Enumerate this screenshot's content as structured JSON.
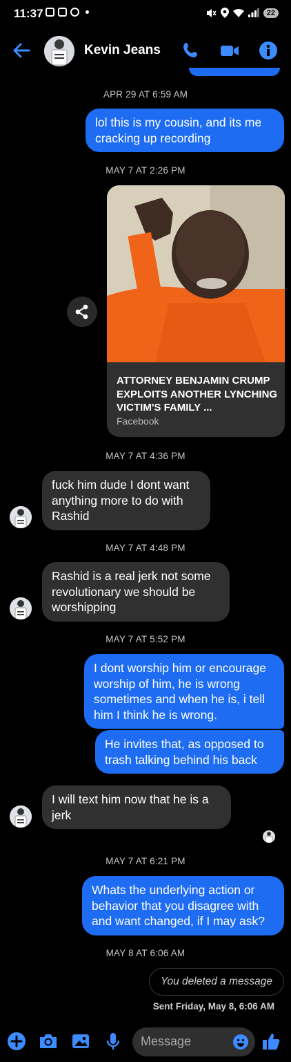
{
  "status_bar": {
    "time": "11:37",
    "battery": "22"
  },
  "header": {
    "contact_name": "Kevin Jeans"
  },
  "conversation": {
    "ts1": "APR 29 AT 6:59 AM",
    "msg1": "lol this is my cousin, and its me cracking up recording",
    "ts2": "MAY 7 AT 2:26 PM",
    "card": {
      "title": "ATTORNEY BENJAMIN CRUMP EXPLOITS ANOTHER LYNCHING VICTIM'S FAMILY ...",
      "source": "Facebook"
    },
    "ts3": "MAY 7 AT 4:36 PM",
    "msg2": "fuck him dude I dont want anything more to do with Rashid",
    "ts4": "MAY 7 AT 4:48 PM",
    "msg3": "Rashid is a real jerk not some revolutionary we should be worshipping",
    "ts5": "MAY 7 AT 5:52 PM",
    "msg4": "I dont worship him or encourage worship of him, he is wrong sometimes and when he is, i tell him I think he is wrong.",
    "msg5": "He invites that, as opposed to trash talking behind his back",
    "msg6": "I will text him now that he is a jerk",
    "ts6": "MAY 7 AT 6:21 PM",
    "msg7": "Whats the underlying action or behavior that you disagree with and want changed, if I may ask?",
    "ts7": "MAY 8 AT 6:06 AM",
    "deleted": "You deleted a message",
    "sent_status": "Sent Friday, May 8, 6:06 AM"
  },
  "composer": {
    "placeholder": "Message"
  },
  "colors": {
    "accent": "#1d6cf2",
    "incoming": "#303030",
    "background": "#000000"
  },
  "icons": {
    "header": [
      "back-arrow-icon",
      "phone-icon",
      "video-icon",
      "info-icon"
    ],
    "composer": [
      "plus-icon",
      "camera-icon",
      "gallery-icon",
      "mic-icon",
      "emoji-icon",
      "thumbs-up-icon"
    ],
    "card": [
      "share-icon"
    ]
  }
}
